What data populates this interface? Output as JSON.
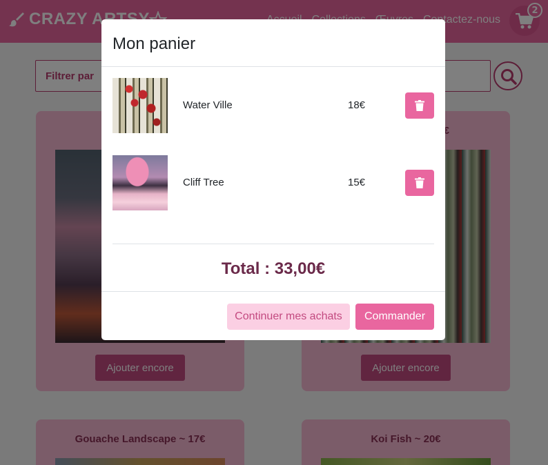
{
  "navbar": {
    "brand": "CRAZY ARTSY",
    "links": [
      "Accueil",
      "Collections",
      "Œuvres",
      "Contactez-nous"
    ],
    "cart_count": "2"
  },
  "filter": {
    "label": "Filtrer par"
  },
  "cards": [
    {
      "title": "",
      "button": "Ajouter encore"
    },
    {
      "title": "€",
      "button": "Ajouter encore"
    },
    {
      "title": "Gouache Landscape ~ 17€",
      "button": ""
    },
    {
      "title": "Koi Fish ~ 20€",
      "button": ""
    }
  ],
  "modal": {
    "title": "Mon panier",
    "items": [
      {
        "name": "Water Ville",
        "price": "18€"
      },
      {
        "name": "Cliff Tree",
        "price": "15€"
      }
    ],
    "total": "Total : 33,00€",
    "continue_label": "Continuer mes achats",
    "order_label": "Commander"
  },
  "colors": {
    "primary": "#e9669f",
    "primary_dark": "#c34a80",
    "card_bg": "#f7b9d3",
    "text_dark": "#6b2a4a"
  }
}
